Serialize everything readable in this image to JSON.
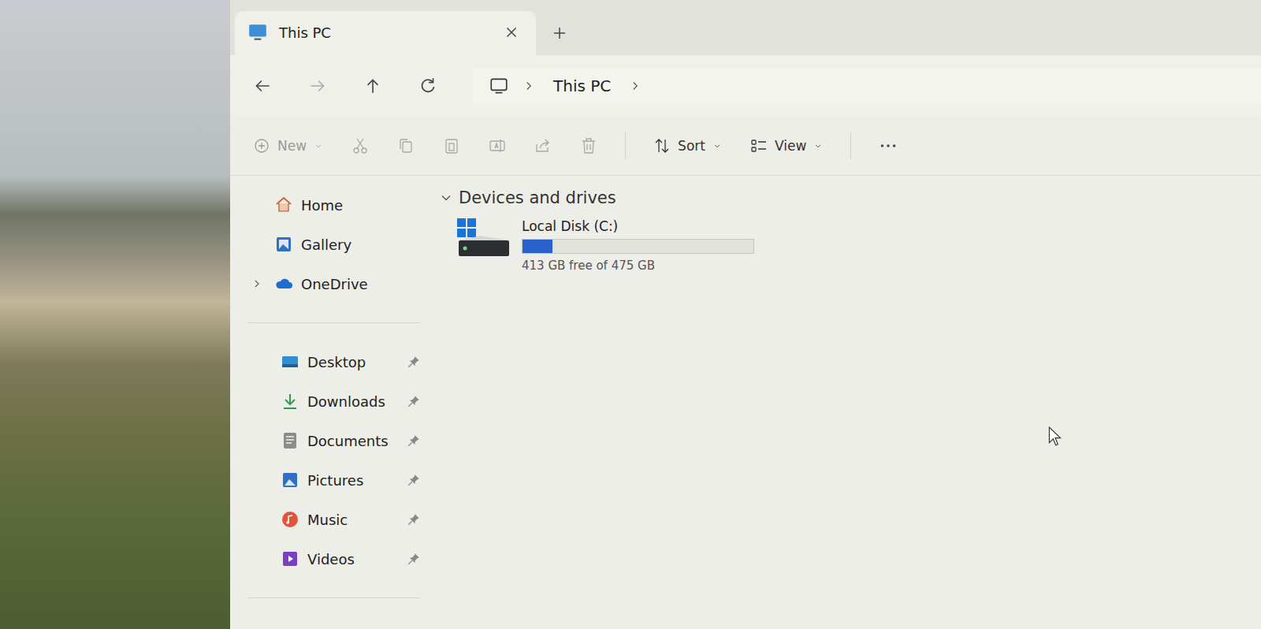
{
  "window": {
    "title": "This PC"
  },
  "tabs": [
    {
      "label": "This PC",
      "selected": true
    }
  ],
  "nav": {
    "back": {
      "disabled": false
    },
    "forward": {
      "disabled": true
    },
    "up": {
      "disabled": false
    }
  },
  "breadcrumb": [
    "This PC"
  ],
  "toolbar": {
    "new": {
      "label": "New",
      "disabled": true
    },
    "actions": [
      {
        "disabled": true
      },
      {
        "disabled": true
      },
      {
        "disabled": true
      },
      {
        "disabled": true
      },
      {
        "disabled": true
      },
      {
        "disabled": true
      }
    ],
    "sort": {
      "label": "Sort"
    },
    "view": {
      "label": "View"
    }
  },
  "sidebar": {
    "items": [
      {
        "label": "Home",
        "expandable": false,
        "expanded": false
      },
      {
        "label": "Gallery",
        "expandable": false,
        "expanded": false
      },
      {
        "label": "OneDrive",
        "expandable": true,
        "expanded": false
      }
    ],
    "pinned": [
      {
        "label": "Desktop",
        "pinned": true
      },
      {
        "label": "Downloads",
        "pinned": true
      },
      {
        "label": "Documents",
        "pinned": true
      },
      {
        "label": "Pictures",
        "pinned": true
      },
      {
        "label": "Music",
        "pinned": true
      },
      {
        "label": "Videos",
        "pinned": true
      }
    ]
  },
  "sections": [
    {
      "title": "Devices and drives",
      "expanded": true,
      "drives": [
        {
          "name": "Local Disk (C:)",
          "level": 0.13,
          "reading": "413 GB free of 475 GB"
        }
      ]
    }
  ]
}
